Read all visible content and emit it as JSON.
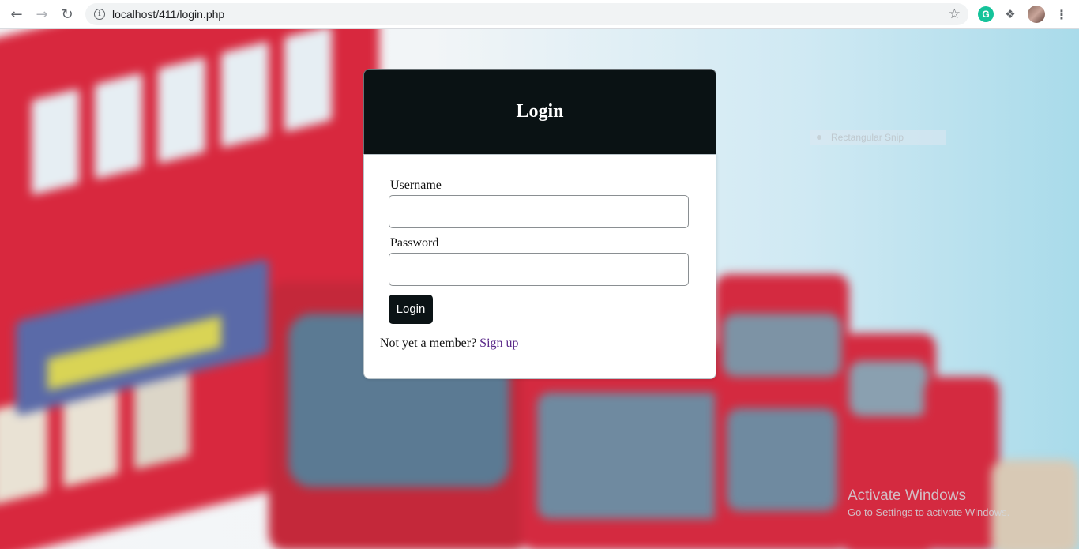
{
  "browser": {
    "url": "localhost/411/login.php",
    "icons": {
      "back": "back-arrow-icon",
      "forward": "forward-arrow-icon",
      "reload": "reload-icon",
      "info": "info-icon",
      "bookmark": "star-icon",
      "grammarly": "grammarly-icon",
      "extensions": "puzzle-icon",
      "profile": "avatar",
      "menu": "kebab-menu-icon"
    },
    "grammarly_letter": "G"
  },
  "login": {
    "title": "Login",
    "username_label": "Username",
    "username_value": "",
    "password_label": "Password",
    "password_value": "",
    "submit_label": "Login",
    "member_prompt": "Not yet a member?",
    "signup_link": "Sign up"
  },
  "overlay": {
    "snip_text": "Rectangular Snip",
    "activate_title": "Activate Windows",
    "activate_subtitle": "Go to Settings to activate Windows."
  },
  "colors": {
    "card_header": "#0a1214",
    "button": "#0b1315",
    "link": "#5b2a8a"
  }
}
